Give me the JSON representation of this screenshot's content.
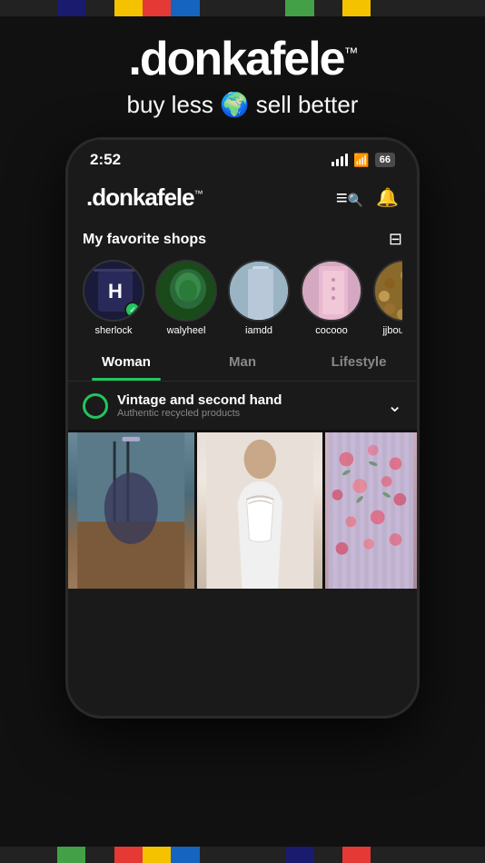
{
  "pixelBorderTop": [
    {
      "color": "#222222",
      "flex": 2
    },
    {
      "color": "#1a1a6e",
      "flex": 1
    },
    {
      "color": "#222222",
      "flex": 1
    },
    {
      "color": "#f5c200",
      "flex": 1
    },
    {
      "color": "#e53935",
      "flex": 1
    },
    {
      "color": "#1565c0",
      "flex": 1
    },
    {
      "color": "#222222",
      "flex": 3
    },
    {
      "color": "#43a047",
      "flex": 1
    },
    {
      "color": "#222222",
      "flex": 1
    },
    {
      "color": "#f5c200",
      "flex": 1
    },
    {
      "color": "#222222",
      "flex": 4
    }
  ],
  "pixelBorderBottom": [
    {
      "color": "#222222",
      "flex": 2
    },
    {
      "color": "#43a047",
      "flex": 1
    },
    {
      "color": "#222222",
      "flex": 1
    },
    {
      "color": "#e53935",
      "flex": 1
    },
    {
      "color": "#f5c200",
      "flex": 1
    },
    {
      "color": "#1565c0",
      "flex": 1
    },
    {
      "color": "#222222",
      "flex": 3
    },
    {
      "color": "#1a1a6e",
      "flex": 1
    },
    {
      "color": "#222222",
      "flex": 1
    },
    {
      "color": "#e53935",
      "flex": 1
    },
    {
      "color": "#222222",
      "flex": 4
    }
  ],
  "header": {
    "logo": ".donkafele",
    "tm": "™",
    "tagline": "buy less 🌍 sell better"
  },
  "phone": {
    "statusBar": {
      "time": "2:52",
      "battery": "66"
    },
    "navbar": {
      "logo": ".donkafele",
      "tm": "™"
    },
    "favoriteShops": {
      "title": "My favorite shops",
      "shops": [
        {
          "name": "sherlock",
          "verified": true,
          "avatarType": "sherlock"
        },
        {
          "name": "walyheel",
          "verified": false,
          "avatarType": "waly"
        },
        {
          "name": "iamdd",
          "verified": false,
          "avatarType": "iamdd"
        },
        {
          "name": "cocooo",
          "verified": false,
          "avatarType": "cocooo"
        },
        {
          "name": "jjboutique",
          "verified": false,
          "avatarType": "jjb"
        }
      ]
    },
    "tabs": [
      {
        "label": "Woman",
        "active": true
      },
      {
        "label": "Man",
        "active": false
      },
      {
        "label": "Lifestyle",
        "active": false
      }
    ],
    "category": {
      "title": "Vintage and second hand",
      "subtitle": "Authentic recycled products"
    },
    "products": [
      {
        "id": 1,
        "colorClass": "prod-1"
      },
      {
        "id": 2,
        "colorClass": "prod-2"
      },
      {
        "id": 3,
        "colorClass": "prod-3"
      }
    ]
  },
  "icons": {
    "menu": "≡",
    "search": "🔍",
    "bell": "🔔",
    "filter": "⊟",
    "chevronDown": "⌄",
    "checkmark": "✓"
  }
}
